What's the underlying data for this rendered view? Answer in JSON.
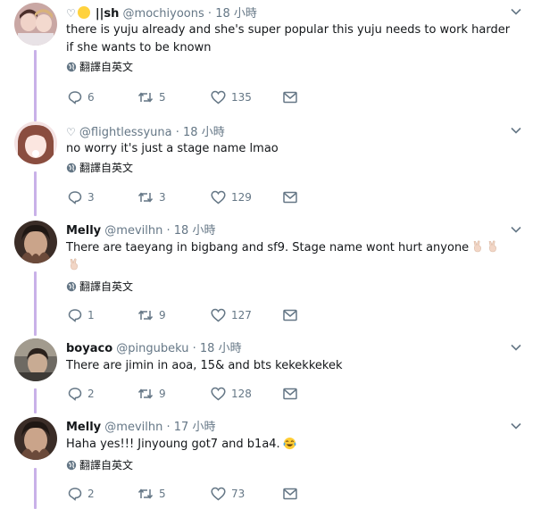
{
  "tweets": [
    {
      "heart_prefix": "♡",
      "display_name": "||sh",
      "handle": "@mochiyoons",
      "separator": "·",
      "time": "18 小時",
      "text": "there is yuju already and she's super popular this yuju needs to work harder if she wants to be known",
      "translate": "翻譯自英文",
      "replies": "6",
      "retweets": "5",
      "likes": "135"
    },
    {
      "heart_prefix": "♡",
      "display_name": "",
      "handle": "@flightlessyuna",
      "separator": "·",
      "time": "18 小時",
      "text": "no worry it's just a stage name lmao",
      "translate": "翻譯自英文",
      "replies": "3",
      "retweets": "3",
      "likes": "129"
    },
    {
      "display_name": "Melly",
      "handle": "@mevilhn",
      "separator": "·",
      "time": "18 小時",
      "text": "There are taeyang in bigbang and sf9. Stage name wont hurt anyone",
      "translate": "翻譯自英文",
      "replies": "1",
      "retweets": "9",
      "likes": "127"
    },
    {
      "display_name": "boyaco",
      "handle": "@pingubeku",
      "separator": "·",
      "time": "18 小時",
      "text": "There are jimin in aoa, 15& and bts kekekkekek",
      "replies": "2",
      "retweets": "9",
      "likes": "128"
    },
    {
      "display_name": "Melly",
      "handle": "@mevilhn",
      "separator": "·",
      "time": "17 小時",
      "text": "Haha yes!!! Jinyoung got7 and b1a4.",
      "translate": "翻譯自英文",
      "replies": "2",
      "retweets": "5",
      "likes": "73"
    }
  ],
  "colors": {
    "thread_line": "#c9b1e8",
    "icon_gray": "#657786",
    "text": "#14171a"
  },
  "icons": [
    "chevron-down-icon",
    "globe-icon",
    "reply-icon",
    "retweet-icon",
    "like-icon",
    "message-icon"
  ]
}
